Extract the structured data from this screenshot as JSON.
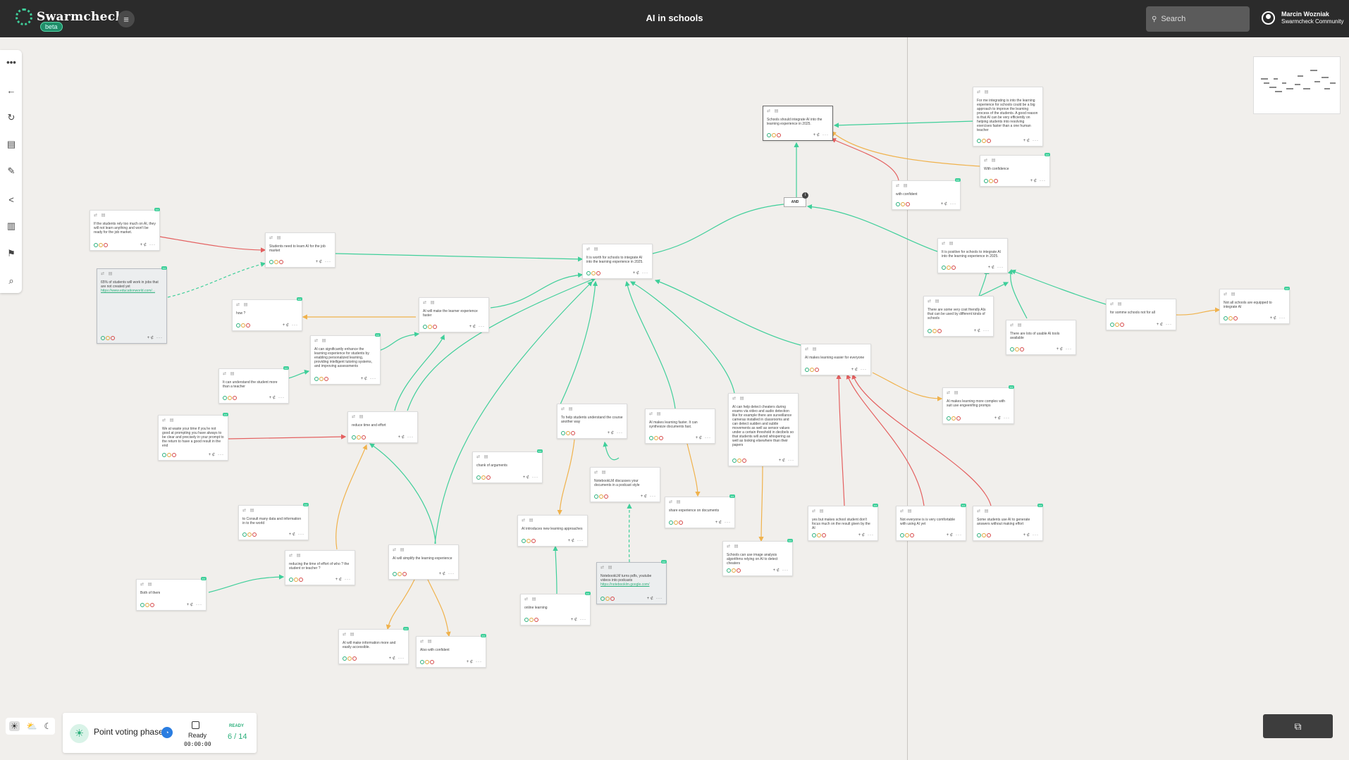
{
  "app": {
    "name": "Swarmcheck",
    "badge": "beta",
    "title": "AI in schools"
  },
  "search": {
    "placeholder": "Search"
  },
  "user": {
    "name": "Marcin Wozniak",
    "community": "Swarmcheck Community"
  },
  "phase": {
    "label": "Point voting phase",
    "ready_label": "Ready",
    "timer": "00:00:00",
    "ready_status": "READY",
    "ready_count": "6 / 14"
  },
  "and_label": "AND",
  "nodes": [
    {
      "text": "Schools should integrate AI into the learning experience in 2025."
    },
    {
      "text": "For me integrating is into the learning experience for schools could be a big approach to improve the learning process of the students. A good reason is that AI can be very efficiently on helping students into resolving exercises faster than a one human teacher"
    },
    {
      "text": "With confidence"
    },
    {
      "text": "with confident"
    },
    {
      "text": "If the students rely too much on AI, they will not learn anything and won't be ready for the job market."
    },
    {
      "text": "Students need to learn AI for the job market"
    },
    {
      "text": "It is worth for schools to integrate AI into the learning experience in 2025."
    },
    {
      "text": "It is positive for schools to integrate AI into the learning experience in 2025."
    },
    {
      "text": "65% of students will work in jobs that are not created yet",
      "link": "https://www.educationworld.com/..."
    },
    {
      "text": "how ?"
    },
    {
      "text": "AI will make the learner experience faster"
    },
    {
      "text": "AI can significantly enhance the learning experience for students by enabling personalized learning, providing intelligent tutoring systems, and improving assessments"
    },
    {
      "text": "There are some very cost friendly AIs that can be used by different kinds of schools"
    },
    {
      "text": "There are lots of usable AI tools available"
    },
    {
      "text": "for somme schools not for all"
    },
    {
      "text": "Not all schools are equipped to integrate AI"
    },
    {
      "text": "It can understand the student more than a teacher"
    },
    {
      "text": "AI makes learning easier for everyone"
    },
    {
      "text": "AI makes learning more complex with suit use engeenifing promps"
    },
    {
      "text": "We at waste your time if you're not good at prompting you have always to be clear and precisely in your prompt to the return to have a good result in the end"
    },
    {
      "text": "reduce time and effort"
    },
    {
      "text": "To help students understand the course another way"
    },
    {
      "text": "AI makes learning faster. It can synthesize documents fast."
    },
    {
      "text": "AI can help detect cheaters during exams via video and audio detection like for example there are surveillance cameras installed in classrooms and can detect sudden and subtle movements as well as sensor values under a certain threshold in decibels so that students will avoid whispering as well as looking elsewhere than their papers"
    },
    {
      "text": "chank of arguments"
    },
    {
      "text": "NotebookLM discusses your documents in a podcast style"
    },
    {
      "text": "share experience on documents"
    },
    {
      "text": "yes but makes school student don't focus much on the result given by the AI"
    },
    {
      "text": "Not everyone is is very comfortable with using AI yet"
    },
    {
      "text": "Some students use AI to generate answers without making effort"
    },
    {
      "text": "to Consult many data and information in to the world"
    },
    {
      "text": "AI introduces new learning approaches"
    },
    {
      "text": "reducing the time of effort of who ? the student or teacher ?"
    },
    {
      "text": "AI will simplify the learning experience"
    },
    {
      "text": "Schools can use image analysis algorithms relying on AI to detect cheaters"
    },
    {
      "text": "NotebookLM turns pdfs, youtube videos into podcasts",
      "link": "https://notebooklm.google.com/"
    },
    {
      "text": "Both of them"
    },
    {
      "text": "online learning"
    },
    {
      "text": "AI will make information more and easily accessible."
    },
    {
      "text": "Also with confident"
    }
  ]
}
